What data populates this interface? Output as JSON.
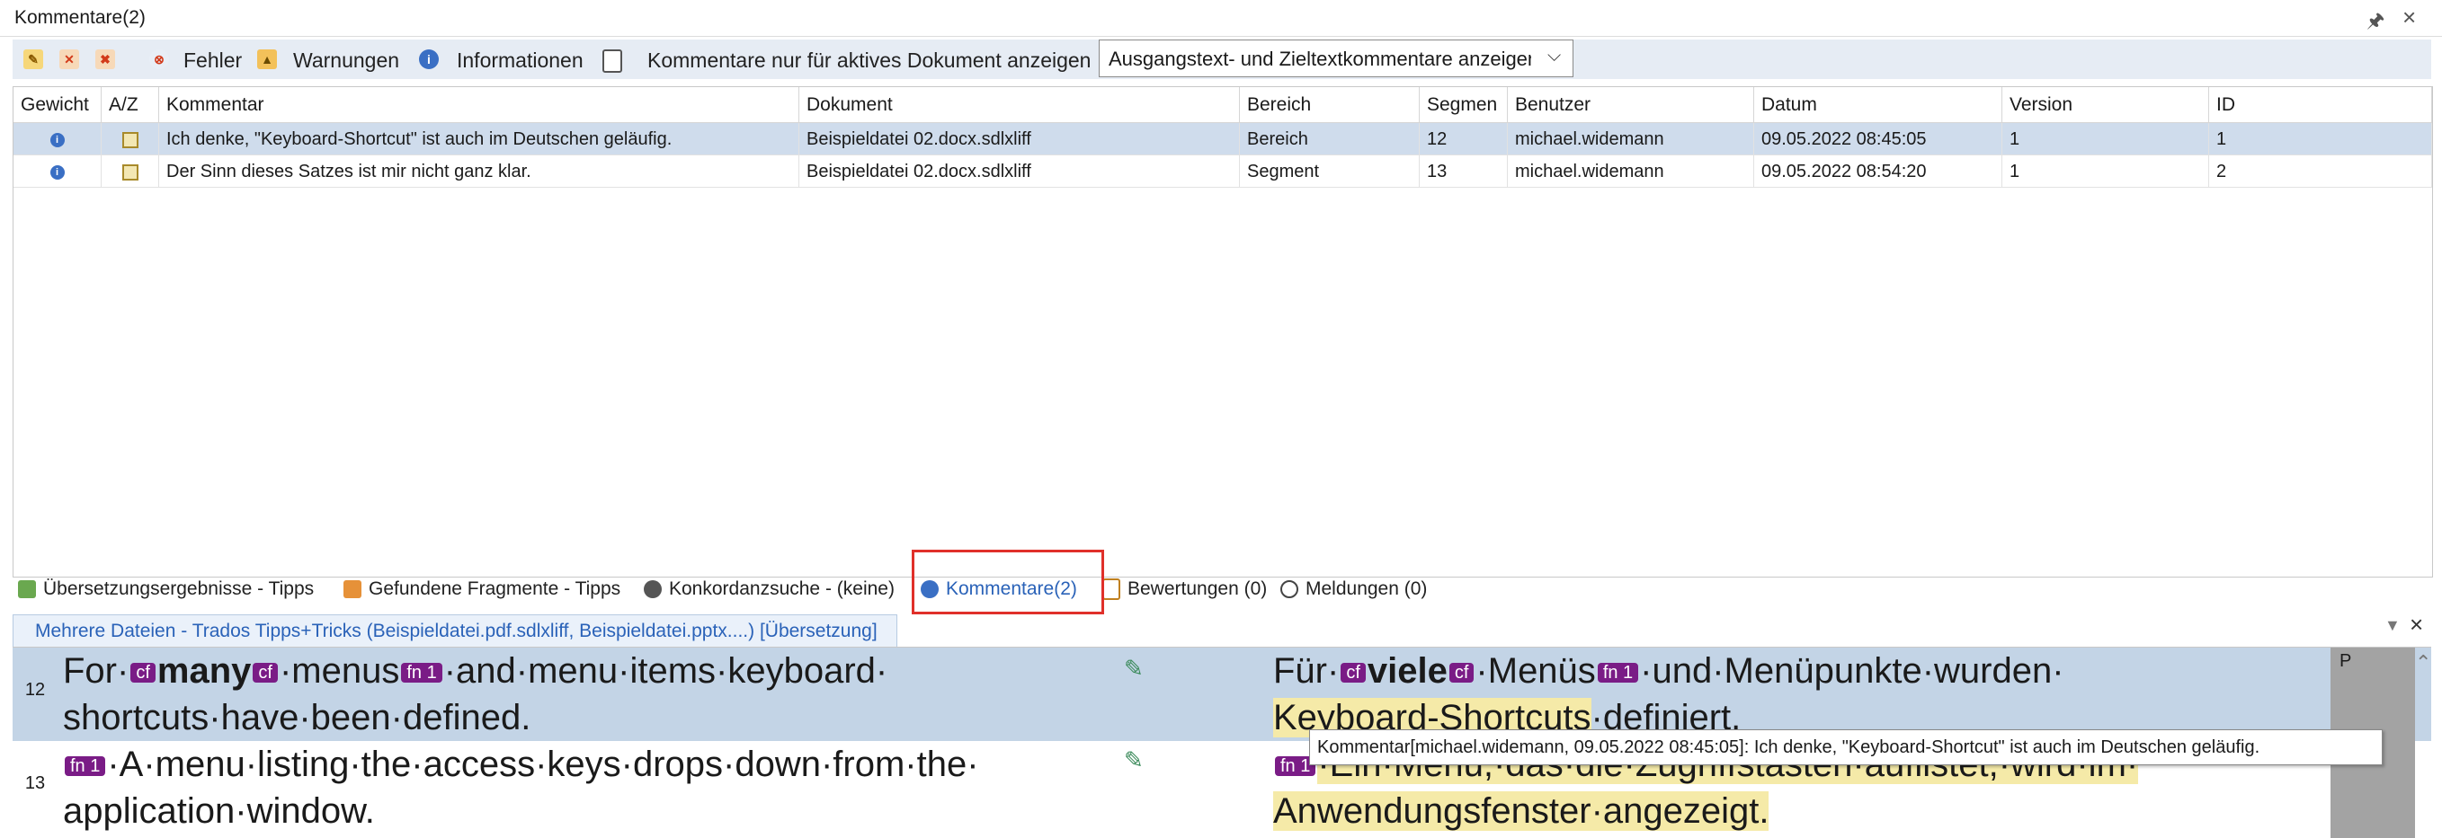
{
  "window": {
    "title": "Kommentare(2)",
    "pin_icon": "pin-icon",
    "close_icon": "close-icon"
  },
  "toolbar": {
    "errors_label": "Fehler",
    "warnings_label": "Warnungen",
    "info_label": "Informationen",
    "active_doc_label": "Kommentare nur für aktives Dokument anzeigen",
    "filter_value": "Ausgangstext- und Zieltextkommentare anzeigen"
  },
  "table": {
    "columns": [
      "Gewicht",
      "A/Z",
      "Kommentar",
      "Dokument",
      "Bereich",
      "Segmen",
      "Benutzer",
      "Datum",
      "Version",
      "ID"
    ],
    "rows": [
      {
        "kommentar": "Ich denke, \"Keyboard-Shortcut\" ist auch im Deutschen geläufig.",
        "dokument": "Beispieldatei 02.docx.sdlxliff",
        "bereich": "Bereich",
        "segment": "12",
        "benutzer": "michael.widemann",
        "datum": "09.05.2022 08:45:05",
        "version": "1",
        "id": "1"
      },
      {
        "kommentar": "Der Sinn dieses Satzes ist mir nicht ganz klar.",
        "dokument": "Beispieldatei 02.docx.sdlxliff",
        "bereich": "Segment",
        "segment": "13",
        "benutzer": "michael.widemann",
        "datum": "09.05.2022 08:54:20",
        "version": "1",
        "id": "2"
      }
    ]
  },
  "tabs": [
    {
      "label": "Übersetzungsergebnisse - Tipps"
    },
    {
      "label": "Gefundene Fragmente - Tipps"
    },
    {
      "label": "Konkordanzsuche - (keine)"
    },
    {
      "label": "Kommentare(2)"
    },
    {
      "label": "Bewertungen (0)"
    },
    {
      "label": "Meldungen (0)"
    }
  ],
  "editor": {
    "doc_tab": "Mehrere Dateien - Trados Tipps+Tricks (Beispieldatei.pdf.sdlxliff, Beispieldatei.pptx....) [Übersetzung]",
    "segments": [
      {
        "num": "12",
        "src_line1_a": "For·",
        "src_bold": "many",
        "src_line1_b": "·menus",
        "src_line1_c": "·and·menu·items·keyboard·",
        "src_line2": "shortcuts·have·been·defined.",
        "tgt_line1_a": "Für·",
        "tgt_bold": "viele",
        "tgt_line1_b": "·Menüs",
        "tgt_line1_c": "·und·Menüpunkte·wurden·",
        "tgt_line2_hl": "Keyboard-Shortcuts",
        "tgt_line2_b": "·definiert.",
        "status": "P"
      },
      {
        "num": "13",
        "src_line1": "·A·menu·listing·the·access·keys·drops·down·from·the·",
        "src_line2": "application·window.",
        "tgt_line1": "·Ein·Menü,·das·die·Zugriffstasten·auflistet,·wird·im·",
        "tgt_line2": "Anwendungsfenster·angezeigt."
      }
    ],
    "tags": {
      "cf": "cf",
      "fn1": "fn 1"
    },
    "tooltip": "Kommentar[michael.widemann, 09.05.2022 08:45:05]: Ich denke, \"Keyboard-Shortcut\" ist auch im Deutschen geläufig."
  },
  "colors": {
    "selection": "#cfdcec",
    "tag": "#7a1c86",
    "highlight": "#f5eaa8",
    "accent_red": "#e0302a",
    "link_blue": "#2a62b8"
  }
}
